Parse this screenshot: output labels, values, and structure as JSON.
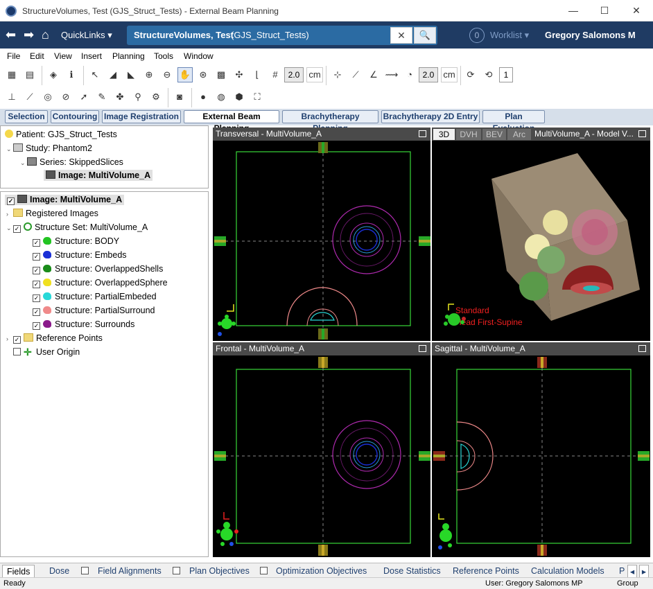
{
  "window": {
    "title": "StructureVolumes, Test (GJS_Struct_Tests) - External Beam Planning",
    "minimize": "—",
    "maximize": "☐",
    "close": "✕"
  },
  "navbar": {
    "quicklinks": "QuickLinks",
    "context_title": "StructureVolumes, Test",
    "context_sub": "(GJS_Struct_Tests)",
    "worklist_count": "0",
    "worklist_label": "Worklist ▾",
    "user": "Gregory Salomons M"
  },
  "menu": [
    "File",
    "Edit",
    "View",
    "Insert",
    "Planning",
    "Tools",
    "Window"
  ],
  "toolbar": {
    "zoom_value1": "2.0",
    "unit1": "cm",
    "zoom_value2": "2.0",
    "unit2": "cm",
    "count": "1"
  },
  "workspaces": [
    "Selection",
    "Contouring",
    "Image Registration",
    "External Beam Planning",
    "Brachytherapy Planning",
    "Brachytherapy 2D Entry",
    "Plan Evaluation"
  ],
  "patient_tree": {
    "patient": "Patient: GJS_Struct_Tests",
    "study": "Study: Phantom2",
    "series": "Series: SkippedSlices",
    "image": "Image: MultiVolume_A"
  },
  "struct_tree": {
    "image": "Image: MultiVolume_A",
    "registered": "Registered Images",
    "structure_set": "Structure Set: MultiVolume_A",
    "structures": [
      {
        "label": "Structure: BODY",
        "color": "#22c422"
      },
      {
        "label": "Structure: Embeds",
        "color": "#1a2fd6"
      },
      {
        "label": "Structure: OverlappedShells",
        "color": "#1a8c1a"
      },
      {
        "label": "Structure: OverlappedSphere",
        "color": "#f0e020"
      },
      {
        "label": "Structure: PartialEmbeded",
        "color": "#28d8d8"
      },
      {
        "label": "Structure: PartialSurround",
        "color": "#f08a8a"
      },
      {
        "label": "Structure: Surrounds",
        "color": "#8a1a8a"
      }
    ],
    "reference_points": "Reference Points",
    "user_origin": "User Origin"
  },
  "viewports": {
    "transversal": "Transversal - MultiVolume_A",
    "frontal": "Frontal - MultiVolume_A",
    "sagittal": "Sagittal - MultiVolume_A",
    "model_tabs": [
      "3D",
      "DVH",
      "BEV",
      "Arc"
    ],
    "model_title": "MultiVolume_A - Model V...",
    "orientation_line1": "Standard",
    "orientation_line2": "Head First-Supine"
  },
  "bottom_tabs": [
    "Fields",
    "Dose",
    "Field Alignments",
    "Plan Objectives",
    "Optimization Objectives",
    "Dose Statistics",
    "Reference Points",
    "Calculation Models",
    "P"
  ],
  "status": {
    "ready": "Ready",
    "user": "User: Gregory Salomons MP",
    "group": "Group"
  }
}
